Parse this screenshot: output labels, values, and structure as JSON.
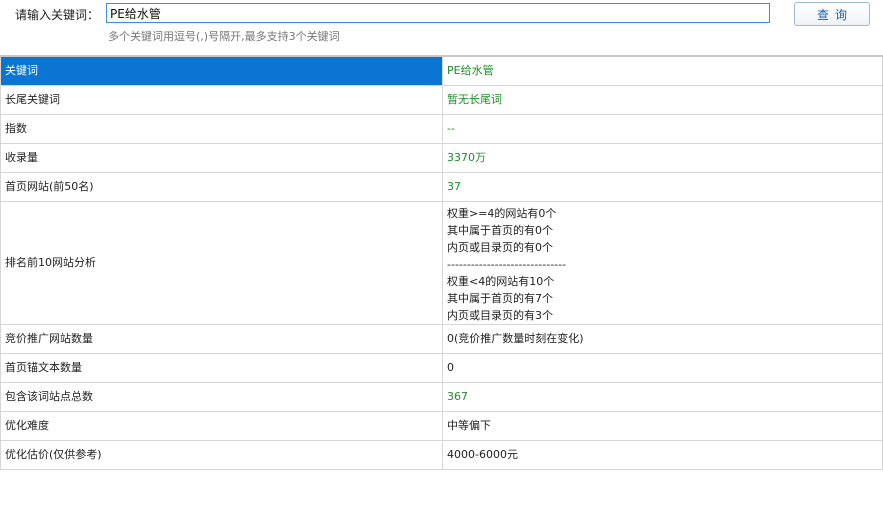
{
  "search": {
    "label": "请输入关键词：",
    "value": "PE给水管",
    "button_label": "查询",
    "hint": "多个关键词用逗号(,)号隔开,最多支持3个关键词"
  },
  "rows": [
    {
      "key": "关键词",
      "value": "PE给水管"
    },
    {
      "key": "长尾关键词",
      "value": "暂无长尾词"
    },
    {
      "key": "指数",
      "value": "--"
    },
    {
      "key": "收录量",
      "value": "3370万"
    },
    {
      "key": "首页网站(前50名)",
      "value": "37"
    },
    {
      "key": "排名前10网站分析",
      "lines": [
        "权重>=4的网站有0个",
        "其中属于首页的有0个",
        "内页或目录页的有0个",
        "------------------------------",
        "权重<4的网站有10个",
        "其中属于首页的有7个",
        "内页或目录页的有3个"
      ]
    },
    {
      "key": "竞价推广网站数量",
      "value": "0(竞价推广数量时刻在变化)"
    },
    {
      "key": "首页锚文本数量",
      "value": "0"
    },
    {
      "key": "包含该词站点总数",
      "value": "367"
    },
    {
      "key": "优化难度",
      "value": "中等偏下"
    },
    {
      "key": "优化估价(仅供参考)",
      "value": "4000-6000元"
    }
  ],
  "colors": {
    "header_bg": "#0a75d2",
    "green_value": "#1b8f2a",
    "accent_border": "#3b8fd6"
  }
}
